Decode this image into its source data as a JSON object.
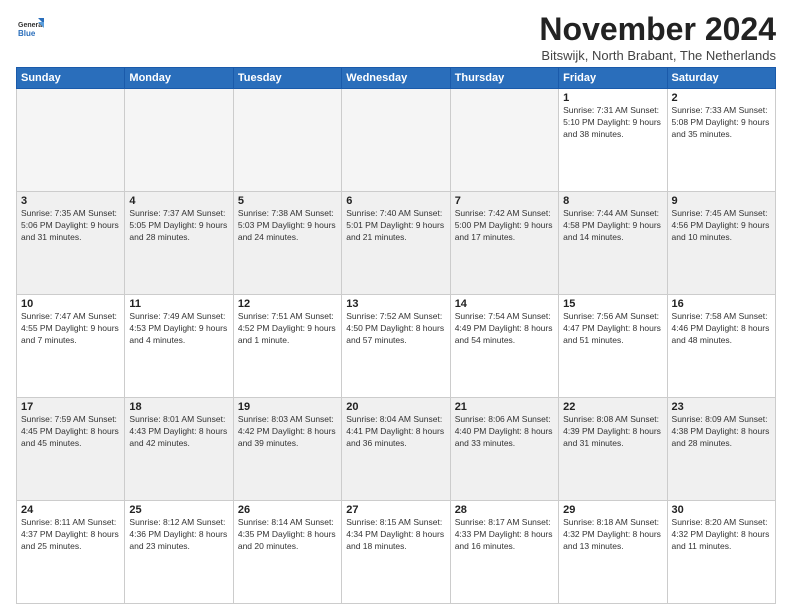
{
  "logo": {
    "general": "General",
    "blue": "Blue"
  },
  "header": {
    "month_year": "November 2024",
    "location": "Bitswijk, North Brabant, The Netherlands"
  },
  "weekdays": [
    "Sunday",
    "Monday",
    "Tuesday",
    "Wednesday",
    "Thursday",
    "Friday",
    "Saturday"
  ],
  "weeks": [
    [
      {
        "day": "",
        "detail": ""
      },
      {
        "day": "",
        "detail": ""
      },
      {
        "day": "",
        "detail": ""
      },
      {
        "day": "",
        "detail": ""
      },
      {
        "day": "",
        "detail": ""
      },
      {
        "day": "1",
        "detail": "Sunrise: 7:31 AM\nSunset: 5:10 PM\nDaylight: 9 hours\nand 38 minutes."
      },
      {
        "day": "2",
        "detail": "Sunrise: 7:33 AM\nSunset: 5:08 PM\nDaylight: 9 hours\nand 35 minutes."
      }
    ],
    [
      {
        "day": "3",
        "detail": "Sunrise: 7:35 AM\nSunset: 5:06 PM\nDaylight: 9 hours\nand 31 minutes."
      },
      {
        "day": "4",
        "detail": "Sunrise: 7:37 AM\nSunset: 5:05 PM\nDaylight: 9 hours\nand 28 minutes."
      },
      {
        "day": "5",
        "detail": "Sunrise: 7:38 AM\nSunset: 5:03 PM\nDaylight: 9 hours\nand 24 minutes."
      },
      {
        "day": "6",
        "detail": "Sunrise: 7:40 AM\nSunset: 5:01 PM\nDaylight: 9 hours\nand 21 minutes."
      },
      {
        "day": "7",
        "detail": "Sunrise: 7:42 AM\nSunset: 5:00 PM\nDaylight: 9 hours\nand 17 minutes."
      },
      {
        "day": "8",
        "detail": "Sunrise: 7:44 AM\nSunset: 4:58 PM\nDaylight: 9 hours\nand 14 minutes."
      },
      {
        "day": "9",
        "detail": "Sunrise: 7:45 AM\nSunset: 4:56 PM\nDaylight: 9 hours\nand 10 minutes."
      }
    ],
    [
      {
        "day": "10",
        "detail": "Sunrise: 7:47 AM\nSunset: 4:55 PM\nDaylight: 9 hours\nand 7 minutes."
      },
      {
        "day": "11",
        "detail": "Sunrise: 7:49 AM\nSunset: 4:53 PM\nDaylight: 9 hours\nand 4 minutes."
      },
      {
        "day": "12",
        "detail": "Sunrise: 7:51 AM\nSunset: 4:52 PM\nDaylight: 9 hours\nand 1 minute."
      },
      {
        "day": "13",
        "detail": "Sunrise: 7:52 AM\nSunset: 4:50 PM\nDaylight: 8 hours\nand 57 minutes."
      },
      {
        "day": "14",
        "detail": "Sunrise: 7:54 AM\nSunset: 4:49 PM\nDaylight: 8 hours\nand 54 minutes."
      },
      {
        "day": "15",
        "detail": "Sunrise: 7:56 AM\nSunset: 4:47 PM\nDaylight: 8 hours\nand 51 minutes."
      },
      {
        "day": "16",
        "detail": "Sunrise: 7:58 AM\nSunset: 4:46 PM\nDaylight: 8 hours\nand 48 minutes."
      }
    ],
    [
      {
        "day": "17",
        "detail": "Sunrise: 7:59 AM\nSunset: 4:45 PM\nDaylight: 8 hours\nand 45 minutes."
      },
      {
        "day": "18",
        "detail": "Sunrise: 8:01 AM\nSunset: 4:43 PM\nDaylight: 8 hours\nand 42 minutes."
      },
      {
        "day": "19",
        "detail": "Sunrise: 8:03 AM\nSunset: 4:42 PM\nDaylight: 8 hours\nand 39 minutes."
      },
      {
        "day": "20",
        "detail": "Sunrise: 8:04 AM\nSunset: 4:41 PM\nDaylight: 8 hours\nand 36 minutes."
      },
      {
        "day": "21",
        "detail": "Sunrise: 8:06 AM\nSunset: 4:40 PM\nDaylight: 8 hours\nand 33 minutes."
      },
      {
        "day": "22",
        "detail": "Sunrise: 8:08 AM\nSunset: 4:39 PM\nDaylight: 8 hours\nand 31 minutes."
      },
      {
        "day": "23",
        "detail": "Sunrise: 8:09 AM\nSunset: 4:38 PM\nDaylight: 8 hours\nand 28 minutes."
      }
    ],
    [
      {
        "day": "24",
        "detail": "Sunrise: 8:11 AM\nSunset: 4:37 PM\nDaylight: 8 hours\nand 25 minutes."
      },
      {
        "day": "25",
        "detail": "Sunrise: 8:12 AM\nSunset: 4:36 PM\nDaylight: 8 hours\nand 23 minutes."
      },
      {
        "day": "26",
        "detail": "Sunrise: 8:14 AM\nSunset: 4:35 PM\nDaylight: 8 hours\nand 20 minutes."
      },
      {
        "day": "27",
        "detail": "Sunrise: 8:15 AM\nSunset: 4:34 PM\nDaylight: 8 hours\nand 18 minutes."
      },
      {
        "day": "28",
        "detail": "Sunrise: 8:17 AM\nSunset: 4:33 PM\nDaylight: 8 hours\nand 16 minutes."
      },
      {
        "day": "29",
        "detail": "Sunrise: 8:18 AM\nSunset: 4:32 PM\nDaylight: 8 hours\nand 13 minutes."
      },
      {
        "day": "30",
        "detail": "Sunrise: 8:20 AM\nSunset: 4:32 PM\nDaylight: 8 hours\nand 11 minutes."
      }
    ]
  ]
}
